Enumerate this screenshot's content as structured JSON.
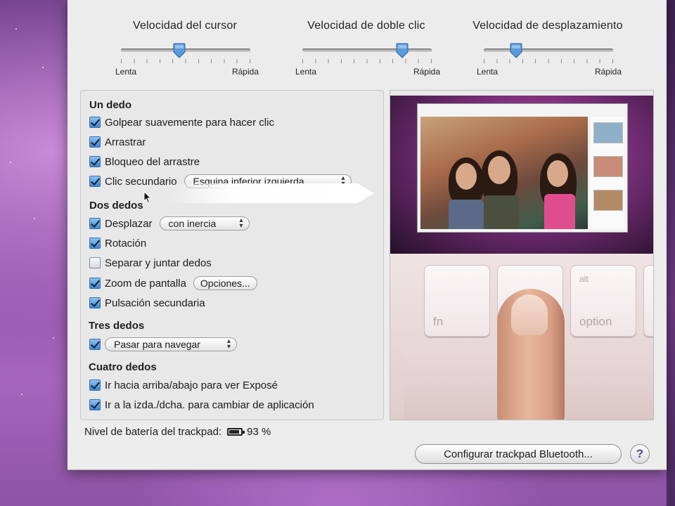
{
  "sliders": [
    {
      "title": "Velocidad del cursor",
      "min_label": "Lenta",
      "max_label": "Rápida",
      "value": 0.45
    },
    {
      "title": "Velocidad de doble clic",
      "min_label": "Lenta",
      "max_label": "Rápida",
      "value": 0.77
    },
    {
      "title": "Velocidad de desplazamiento",
      "min_label": "Lenta",
      "max_label": "Rápida",
      "value": 0.25
    }
  ],
  "sections": {
    "one_finger": {
      "title": "Un dedo",
      "tap_to_click": {
        "label": "Golpear suavemente para hacer clic",
        "checked": true
      },
      "dragging": {
        "label": "Arrastrar",
        "checked": true
      },
      "drag_lock": {
        "label": "Bloqueo del arrastre",
        "checked": true
      },
      "secondary_click": {
        "label": "Clic secundario",
        "checked": true,
        "popup_value": "Esquina inferior izquierda"
      }
    },
    "two_fingers": {
      "title": "Dos dedos",
      "scroll": {
        "label": "Desplazar",
        "checked": true,
        "popup_value": "con inercia"
      },
      "rotate": {
        "label": "Rotación",
        "checked": true
      },
      "pinch": {
        "label": "Separar y juntar dedos",
        "checked": false
      },
      "screen_zoom": {
        "label": "Zoom de pantalla",
        "checked": true,
        "button_label": "Opciones..."
      },
      "secondary_tap": {
        "label": "Pulsación secundaria",
        "checked": true
      }
    },
    "three_fingers": {
      "title": "Tres dedos",
      "navigate": {
        "checked": true,
        "popup_value": "Pasar para navegar"
      }
    },
    "four_fingers": {
      "title": "Cuatro dedos",
      "expose": {
        "label": "Ir hacia arriba/abajo para ver Exposé",
        "checked": true
      },
      "switch_app": {
        "label": "Ir a la izda./dcha. para cambiar de aplicación",
        "checked": true
      }
    }
  },
  "preview": {
    "key_fn": "fn",
    "key_option": "option",
    "key_alt": "alt"
  },
  "battery": {
    "label": "Nivel de batería del trackpad:",
    "value": "93 %"
  },
  "configure_button": "Configurar trackpad Bluetooth...",
  "help_button": "?",
  "colors": {
    "accent": "#3d86d2",
    "help": "#5b3e9e"
  }
}
